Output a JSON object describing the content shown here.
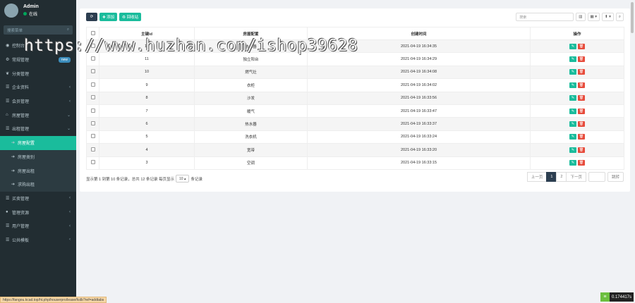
{
  "user": {
    "name": "Admin",
    "status": "在线"
  },
  "sidebar": {
    "search_placeholder": "搜索菜单",
    "items": [
      {
        "label": "控制台",
        "icon": "dashboard-icon",
        "chev": ""
      },
      {
        "label": "常规管理",
        "icon": "cogs-icon",
        "badge": "new"
      },
      {
        "label": "分类管理",
        "icon": "leaf-icon",
        "chev": ""
      },
      {
        "label": "企业资料",
        "icon": "list-icon",
        "chev": "‹"
      },
      {
        "label": "会员管理",
        "icon": "list-icon",
        "chev": "‹"
      },
      {
        "label": "房屋管理",
        "icon": "bank-icon",
        "chev": "⌄"
      },
      {
        "label": "出租管理",
        "icon": "list-icon",
        "chev": "⌄"
      },
      {
        "label": "房屋配置",
        "icon": "circle-arrow-icon",
        "sub": true,
        "active": true
      },
      {
        "label": "房屋类别",
        "icon": "circle-arrow-icon",
        "sub": true
      },
      {
        "label": "房屋出租",
        "icon": "circle-arrow-icon",
        "sub": true
      },
      {
        "label": "求购出租",
        "icon": "circle-arrow-icon",
        "sub": true
      },
      {
        "label": "买卖管理",
        "icon": "list-icon",
        "chev": "‹"
      },
      {
        "label": "管理资源",
        "icon": "user-icon",
        "chev": "‹"
      },
      {
        "label": "用户管理",
        "icon": "list-icon",
        "chev": "‹"
      },
      {
        "label": "公共模板",
        "icon": "list-icon",
        "chev": "‹"
      }
    ]
  },
  "toolbar": {
    "refresh_label": "⟳",
    "add_label": "✚ 添加",
    "recycle_label": "♻ 回收站",
    "search_placeholder": "搜索",
    "view_icon": "▥",
    "columns_icon": "▦ ▾",
    "export_icon": "⬆ ▾",
    "search_btn": "⌕"
  },
  "table": {
    "headers": [
      "主键id",
      "房屋配置",
      "创建时间",
      "操作"
    ],
    "rows": [
      {
        "id": "12",
        "name": "热水器",
        "time": "2021-04-19 16:34:35"
      },
      {
        "id": "11",
        "name": "独立阳台",
        "time": "2021-04-19 16:34:29"
      },
      {
        "id": "10",
        "name": "燃气灶",
        "time": "2021-04-19 16:34:08"
      },
      {
        "id": "9",
        "name": "衣柜",
        "time": "2021-04-19 16:34:02"
      },
      {
        "id": "8",
        "name": "沙发",
        "time": "2021-04-19 16:33:56"
      },
      {
        "id": "7",
        "name": "暖气",
        "time": "2021-04-19 16:33:47"
      },
      {
        "id": "6",
        "name": "热水器",
        "time": "2021-04-19 16:33:37"
      },
      {
        "id": "5",
        "name": "洗衣机",
        "time": "2021-04-19 16:33:24"
      },
      {
        "id": "4",
        "name": "宽带",
        "time": "2021-04-19 16:33:20"
      },
      {
        "id": "3",
        "name": "空调",
        "time": "2021-04-19 16:33:15"
      }
    ],
    "edit_icon": "✎",
    "delete_icon": "🗑"
  },
  "footer": {
    "info_prefix": "显示第 1 到第 10 条记录，总共 12 条记录 每页显示",
    "page_size": "10 ▴",
    "info_suffix": "条记录",
    "prev": "上一页",
    "pages": [
      "1",
      "2"
    ],
    "next": "下一页",
    "jump": "跳转"
  },
  "watermark": "https://www.huzhan.com/ishop39628",
  "statusbar": "https://fangou.kcad.top/ht.php/houserpro/lease/fcdb?ref=addtabs",
  "timer": "0.174417s"
}
